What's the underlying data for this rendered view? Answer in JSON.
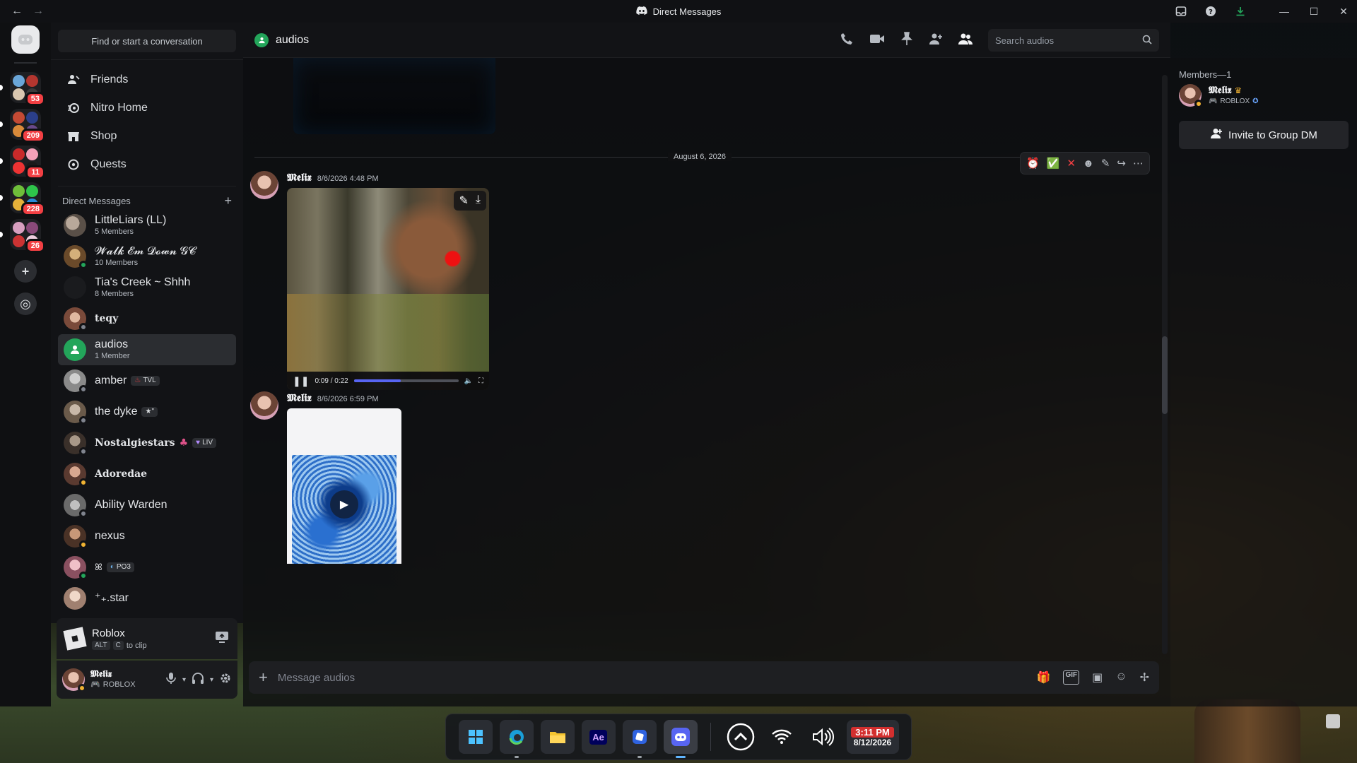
{
  "window": {
    "title": "Direct Messages",
    "nav_back": "←",
    "nav_forward": "→",
    "controls": {
      "minimize": "—",
      "maximize": "☐",
      "close": "✕"
    }
  },
  "servers": [
    {
      "badge": "53"
    },
    {
      "badge": "209"
    },
    {
      "badge": "11"
    },
    {
      "badge": "228"
    },
    {
      "badge": "26"
    }
  ],
  "rail_buttons": {
    "add": "+",
    "discover": "◎"
  },
  "sidebar": {
    "search_label": "Find or start a conversation",
    "nav": [
      {
        "label": "Friends",
        "icon": "friends-icon"
      },
      {
        "label": "Nitro Home",
        "icon": "nitro-icon"
      },
      {
        "label": "Shop",
        "icon": "shop-icon"
      },
      {
        "label": "Quests",
        "icon": "quests-icon"
      }
    ],
    "dm_header": "Direct Messages",
    "dm_add": "+",
    "dms": [
      {
        "name": "LittleLiars (LL)",
        "sub": "5 Members",
        "color": "#6d6f75"
      },
      {
        "name": "𝓦𝓪𝓵𝓴 𝓔𝓶 𝓓𝓸𝔀𝓷 𝓖𝓒",
        "sub": "10 Members",
        "color": "#8a6a4a"
      },
      {
        "name": "Tia's Creek ~ Shhh",
        "sub": "8 Members",
        "color": "#2b2d31"
      },
      {
        "name": "teqy",
        "color": "#7a4a3a"
      },
      {
        "name": "audios",
        "sub": "1 Member",
        "color": "#23a55a"
      },
      {
        "name": "amber",
        "tag": "TVL",
        "color": "#9a9a9a"
      },
      {
        "name": "the dyke",
        "tag": "★\"",
        "color": "#8a7a6a"
      },
      {
        "name": "Nostalgiestars",
        "tag": "LIV",
        "color": "#6a5a5a"
      },
      {
        "name": "Adoredae",
        "color": "#5a3a30"
      },
      {
        "name": "Ability Warden",
        "color": "#8a8a8a"
      },
      {
        "name": "nexus",
        "color": "#5a4032"
      },
      {
        "name": "ꕤ",
        "tag": "PO3",
        "color": "#b07080"
      },
      {
        "name": "⁺₊.star",
        "color": "#c0a090"
      }
    ]
  },
  "activity": {
    "game": "Roblox",
    "hint_keys": [
      "ALT",
      "C"
    ],
    "hint_text": "to clip"
  },
  "user": {
    "name": "𝕸𝖊𝖑𝖎𝖝",
    "status": "ROBLOX"
  },
  "chat": {
    "channel_name": "audios",
    "search_placeholder": "Search audios",
    "date_divider": "August 6, 2026",
    "messages": [
      {
        "author": "𝕸𝖊𝖑𝖎𝖝",
        "timestamp": "8/6/2026 4:48 PM",
        "video": {
          "time": "0:09 / 0:22",
          "progress": 0.45
        }
      },
      {
        "author": "𝕸𝖊𝖑𝖎𝖝",
        "timestamp": "8/6/2026 6:59 PM"
      }
    ],
    "composer_placeholder": "Message audios",
    "composer_tools": [
      "gift-icon",
      "gif-icon",
      "sticker-icon",
      "emoji-icon",
      "apps-icon"
    ],
    "gif_label": "GIF"
  },
  "members": {
    "header": "Members—1",
    "list": [
      {
        "name": "𝕸𝖊𝖑𝖎𝖝",
        "activity": "ROBLOX"
      }
    ],
    "invite_label": "Invite to Group DM"
  },
  "taskbar": {
    "apps": [
      "start-icon",
      "edge-icon",
      "explorer-icon",
      "after-effects-icon",
      "app-icon",
      "discord-icon"
    ],
    "ae_label": "Ae",
    "time": "3:11 PM",
    "date": "8/12/2026"
  },
  "colors": {
    "accent": "#5865f2",
    "online": "#23a55a",
    "badge": "#f23f43"
  }
}
